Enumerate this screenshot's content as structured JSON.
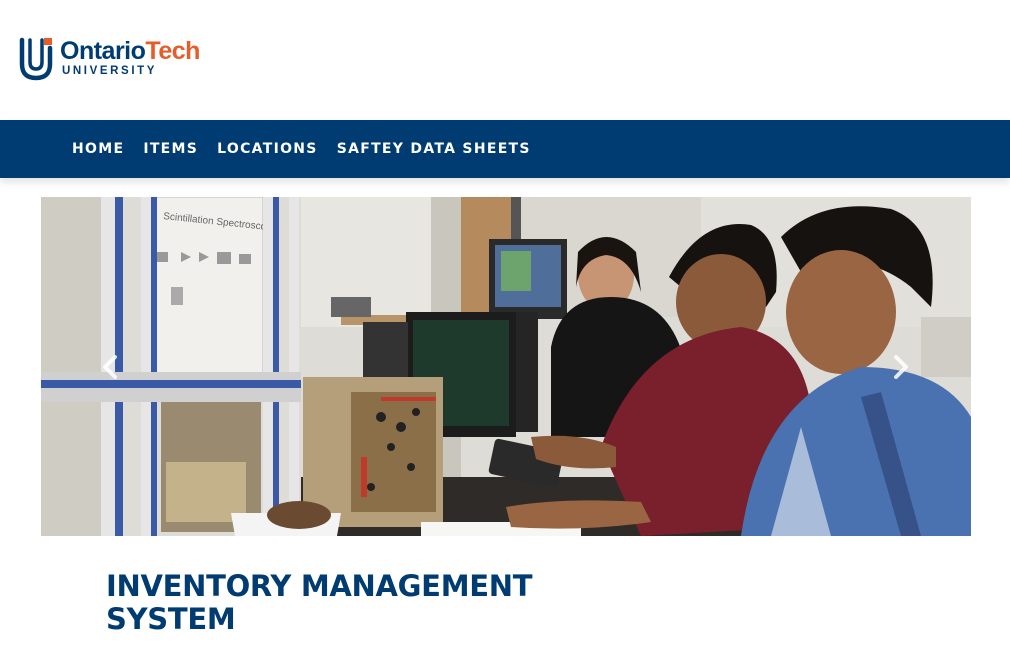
{
  "brand": {
    "name_primary": "Ontario",
    "name_secondary": "Tech",
    "tagline": "UNIVERSITY",
    "colors": {
      "navy": "#003c71",
      "orange": "#e75d2a"
    }
  },
  "nav": {
    "items": [
      {
        "label": "HOME"
      },
      {
        "label": "ITEMS"
      },
      {
        "label": "LOCATIONS"
      },
      {
        "label": "SAFTEY DATA SHEETS"
      }
    ]
  },
  "hero": {
    "poster_text": "Scintillation Spectroscopy",
    "prev_icon": "chevron-left-icon",
    "next_icon": "chevron-right-icon"
  },
  "page": {
    "title_line1": "INVENTORY MANAGEMENT",
    "title_line2": "SYSTEM"
  }
}
